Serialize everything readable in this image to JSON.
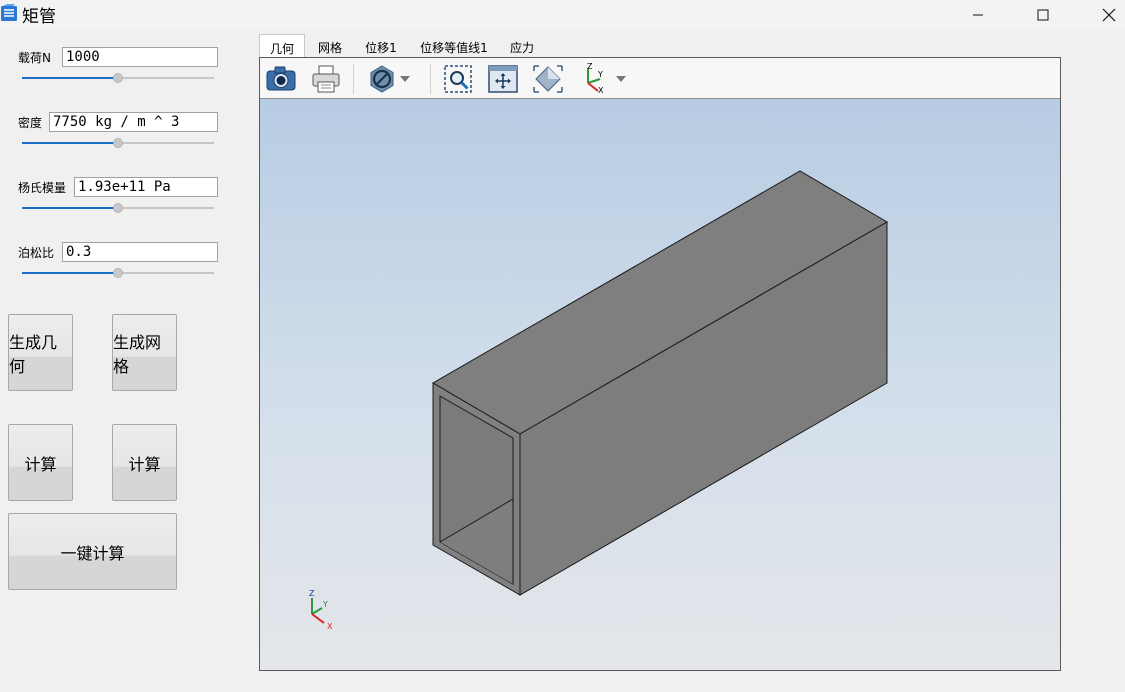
{
  "window": {
    "title": "矩管"
  },
  "params": [
    {
      "label": "载荷N",
      "value": "1000",
      "slider": 0.5
    },
    {
      "label": "密度",
      "value": "7750 kg / m ^ 3",
      "slider": 0.5
    },
    {
      "label": "杨氏模量",
      "value": "1.93e+11 Pa",
      "slider": 0.5
    },
    {
      "label": "泊松比",
      "value": "0.3",
      "slider": 0.5
    }
  ],
  "buttons": {
    "gen_geometry": "生成几何",
    "gen_mesh": "生成网格",
    "compute1": "计算",
    "compute2": "计算",
    "one_click": "一键计算"
  },
  "tabs": [
    "几何",
    "网格",
    "位移1",
    "位移等值线1",
    "应力"
  ],
  "active_tab": 0,
  "toolbar_icons": [
    "camera-icon",
    "printer-icon",
    "clipping-icon",
    "dropdown-arrow-icon",
    "zoom-box-icon",
    "fit-all-icon",
    "view-iso-icon",
    "axes-icon",
    "dropdown-arrow-icon"
  ],
  "axis_labels": {
    "x": "X",
    "y": "Y",
    "z": "Z"
  },
  "colors": {
    "slider_accent": "#1a6fc4",
    "model_gray": "#808080",
    "bg_top": "#b7cce3",
    "bg_bottom": "#e4e6ea"
  }
}
